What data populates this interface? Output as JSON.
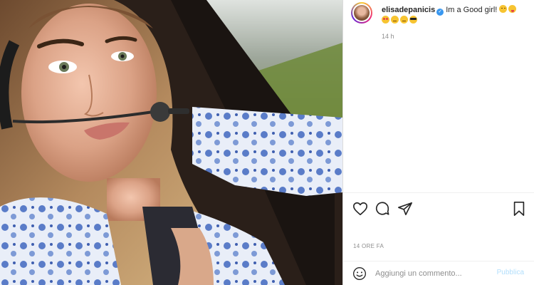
{
  "post": {
    "username": "elisadepanicis",
    "caption_text": "Im a Good girl!",
    "caption_emojis": [
      "wink-emoji",
      "tongue-emoji",
      "heart-eyes-emoji",
      "smirk-emoji",
      "smirk-emoji",
      "sunglasses-emoji"
    ],
    "time_short": "14 h",
    "timestamp": "14 ORE FA"
  },
  "comment_box": {
    "placeholder": "Aggiungi un commento...",
    "publish_label": "Pubblica"
  },
  "icons": [
    "heart-icon",
    "comment-icon",
    "share-icon",
    "bookmark-icon",
    "emoji-icon",
    "verified-badge-icon"
  ],
  "colors": {
    "accent": "#3897f0",
    "muted": "#8e8e8e",
    "publish_disabled": "#b2dffc",
    "border": "#dbdbdb"
  }
}
